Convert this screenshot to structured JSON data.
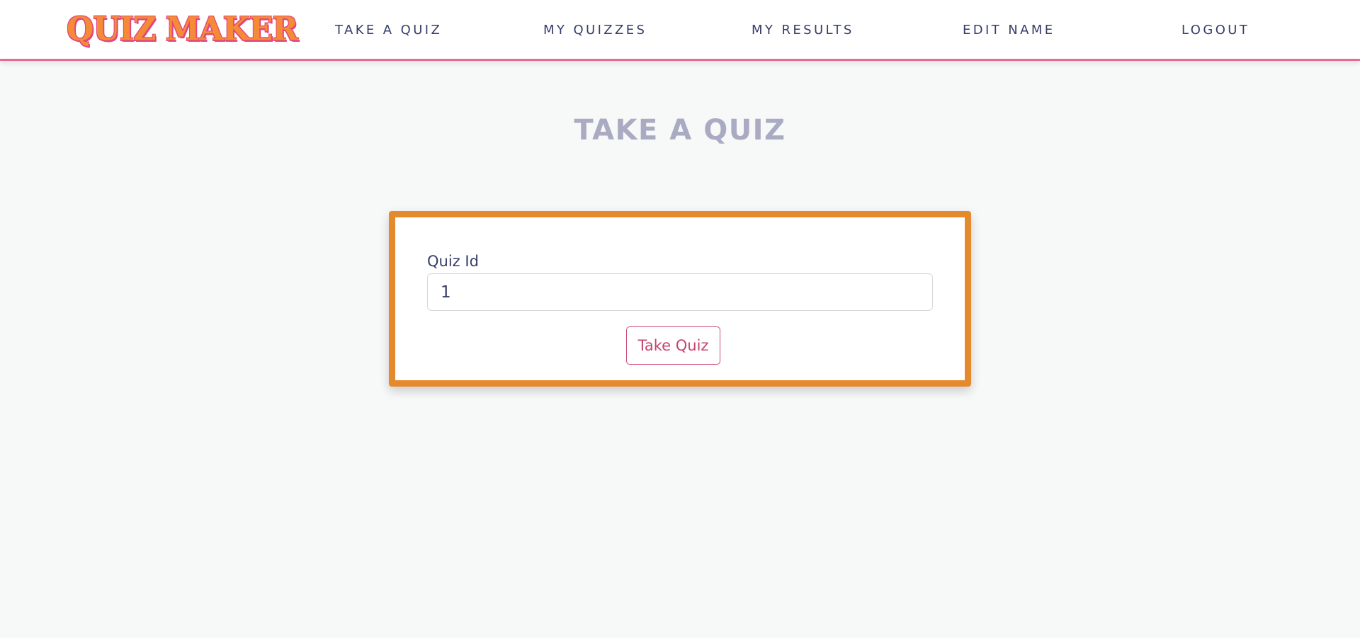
{
  "navbar": {
    "logo_text": "QUIZ MAKER",
    "links": [
      {
        "label": "TAKE A QUIZ"
      },
      {
        "label": "MY QUIZZES"
      },
      {
        "label": "MY RESULTS"
      },
      {
        "label": "EDIT NAME"
      },
      {
        "label": "LOGOUT"
      }
    ]
  },
  "main": {
    "title": "TAKE A QUIZ",
    "form": {
      "quiz_id_label": "Quiz Id",
      "quiz_id_value": "1",
      "submit_label": "Take Quiz"
    }
  },
  "colors": {
    "accent_orange": "#e58a2c",
    "accent_pink": "#e56a96",
    "nav_text": "#363d6a",
    "title_text": "#a9abc2",
    "button_text": "#c4456f"
  }
}
